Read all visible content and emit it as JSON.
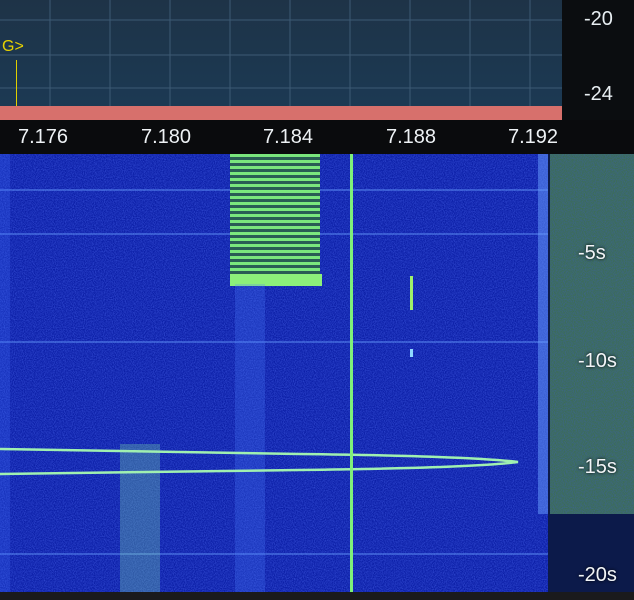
{
  "spectrum": {
    "db_labels": [
      "-20",
      "-24"
    ],
    "marker_label": "G>"
  },
  "frequency_axis": {
    "labels": [
      "7.176",
      "7.180",
      "7.184",
      "7.188",
      "7.192"
    ]
  },
  "waterfall": {
    "time_labels": [
      "-5s",
      "-10s",
      "-15s",
      "-20s"
    ]
  },
  "colors": {
    "waterfall_bg": "#0b1ea6",
    "signal": "#7ff07a",
    "noise_floor": "#d7706c",
    "marker": "#e0d000"
  }
}
